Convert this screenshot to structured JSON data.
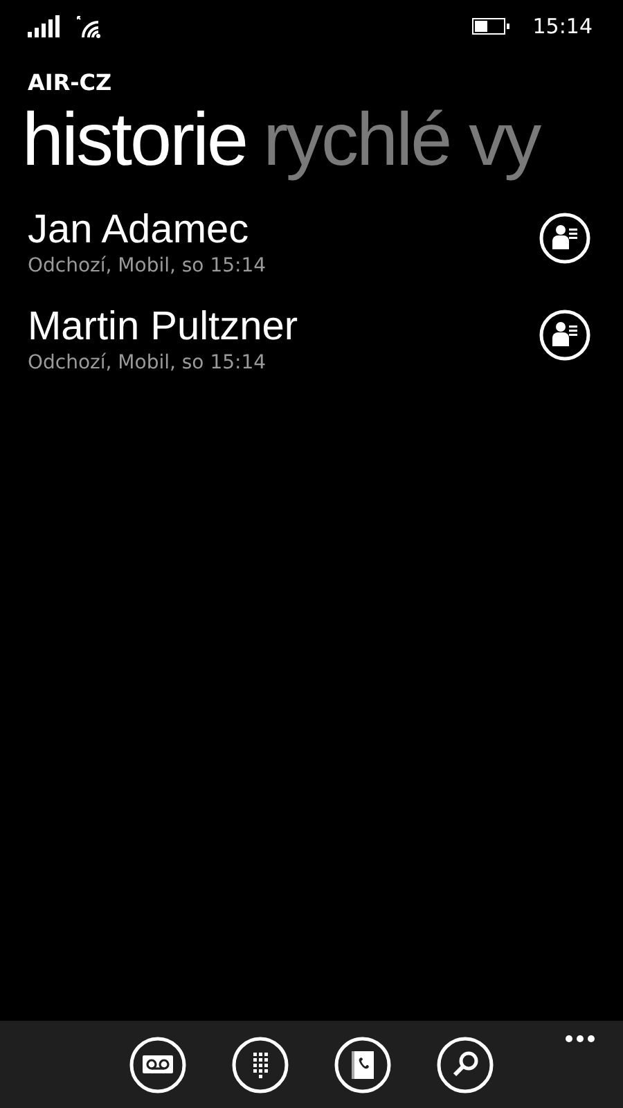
{
  "status_bar": {
    "time": "15:14"
  },
  "app_title": "AIR-CZ",
  "pivot": [
    {
      "label": "historie",
      "selected": true
    },
    {
      "label": "rychlé vy",
      "selected": false
    }
  ],
  "calls": [
    {
      "name": "Jan Adamec",
      "detail": "Odchozí, Mobil, so 15:14"
    },
    {
      "name": "Martin Pultzner",
      "detail": "Odchozí, Mobil, so 15:14"
    }
  ],
  "app_bar": [
    {
      "kind": "voicemail"
    },
    {
      "kind": "keypad"
    },
    {
      "kind": "contacts"
    },
    {
      "kind": "search"
    }
  ]
}
